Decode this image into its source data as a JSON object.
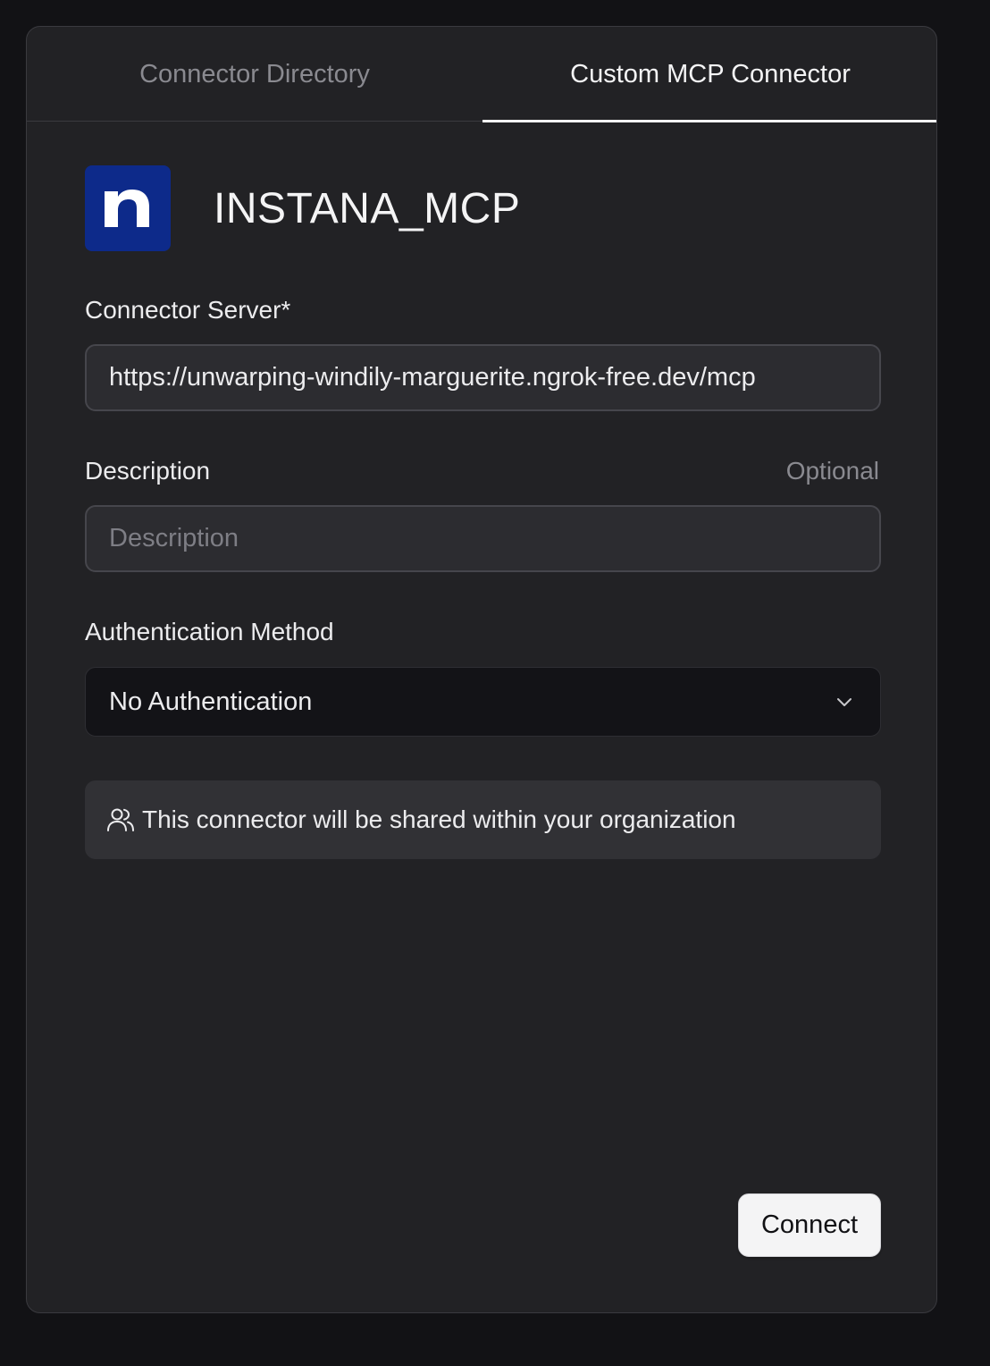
{
  "tabs": [
    {
      "label": "Connector Directory",
      "active": false
    },
    {
      "label": "Custom MCP Connector",
      "active": true
    }
  ],
  "connector": {
    "name": "INSTANA_MCP",
    "logo_letter": "n",
    "logo_color": "#0d2a8a"
  },
  "form": {
    "server_label": "Connector Server*",
    "server_value": "https://unwarping-windily-marguerite.ngrok-free.dev/mcp",
    "description_label": "Description",
    "description_optional": "Optional",
    "description_placeholder": "Description",
    "auth_label": "Authentication Method",
    "auth_selected": "No Authentication"
  },
  "notice": {
    "icon": "users-icon",
    "text": "This connector will be shared within your organization"
  },
  "actions": {
    "connect_label": "Connect"
  }
}
